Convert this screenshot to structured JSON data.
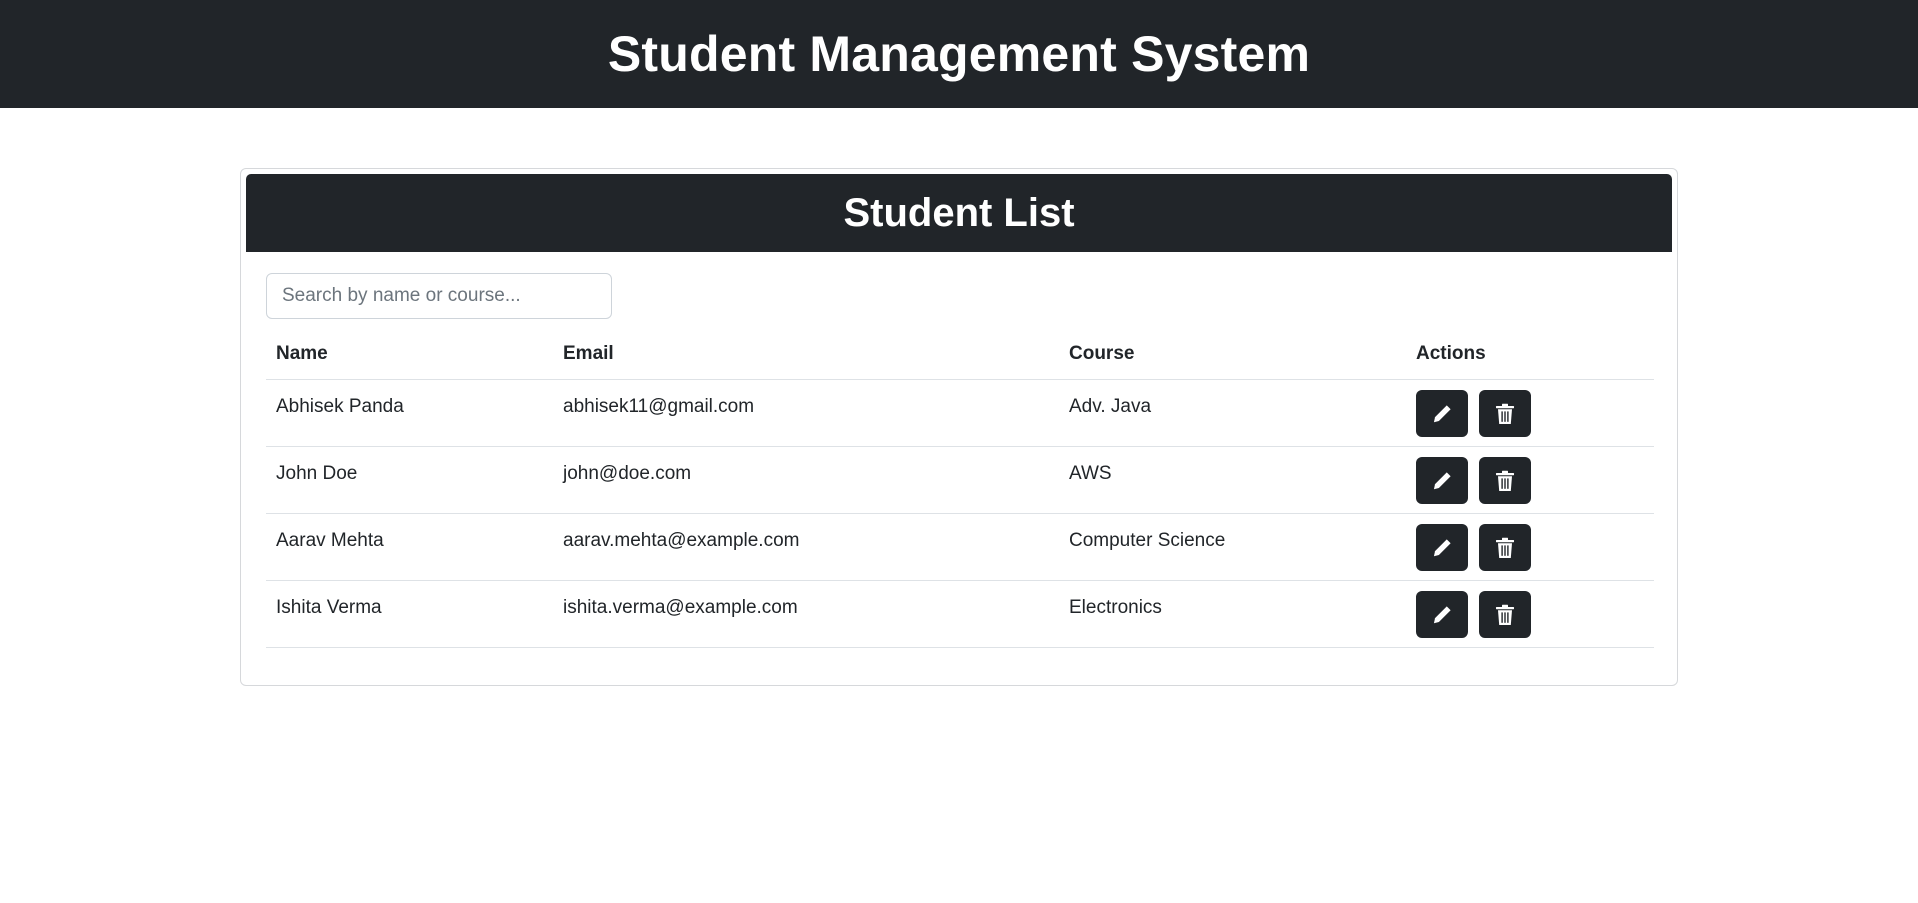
{
  "app": {
    "title": "Student Management System"
  },
  "card": {
    "title": "Student List"
  },
  "search": {
    "placeholder": "Search by name or course..."
  },
  "table": {
    "headers": {
      "name": "Name",
      "email": "Email",
      "course": "Course",
      "actions": "Actions"
    },
    "rows": [
      {
        "name": "Abhisek Panda",
        "email": "abhisek11@gmail.com",
        "course": "Adv. Java"
      },
      {
        "name": "John Doe",
        "email": "john@doe.com",
        "course": "AWS"
      },
      {
        "name": "Aarav Mehta",
        "email": "aarav.mehta@example.com",
        "course": "Computer Science"
      },
      {
        "name": "Ishita Verma",
        "email": "ishita.verma@example.com",
        "course": "Electronics"
      }
    ],
    "row_actions": [
      {
        "icon": "pencil-icon"
      },
      {
        "icon": "trash-icon"
      }
    ]
  },
  "colors": {
    "header_bg": "#212529",
    "header_text": "#ffffff",
    "border": "#dee2e6"
  }
}
